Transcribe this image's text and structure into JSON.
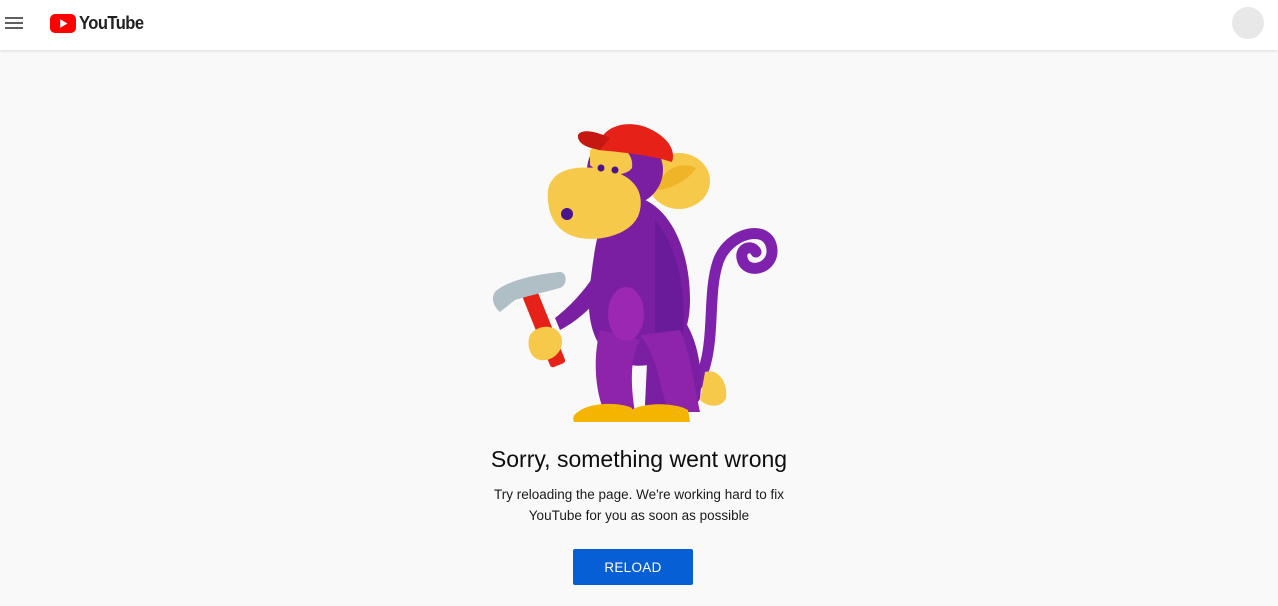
{
  "header": {
    "logo_text": "YouTube",
    "menu_icon": "hamburger-menu-icon",
    "avatar_icon": "account-avatar"
  },
  "error": {
    "illustration": "monkey-with-hammer",
    "title": "Sorry, something went wrong",
    "message_line1": "Try reloading the page. We're working hard to fix",
    "message_line2": "YouTube for you as soon as possible",
    "reload_label": "RELOAD"
  },
  "colors": {
    "brand_red": "#ff0000",
    "button_blue": "#065fd4",
    "background": "#f9f9f9"
  }
}
